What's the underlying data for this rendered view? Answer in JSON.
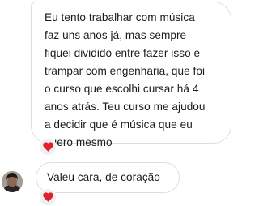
{
  "messages": [
    {
      "lines": [
        "Eu tento trabalhar com música",
        "faz uns anos já, mas sempre",
        "fiquei dividido entre fazer isso e",
        "trampar com engenharia, que foi",
        "o curso que escolhi cursar há 4",
        "anos atrás. Teu curso me ajudou",
        "a decidir que é música que eu",
        "quero mesmo"
      ],
      "reaction": "red-heart-icon"
    },
    {
      "text": "Valeu cara, de coração",
      "reaction": "red-heart-icon"
    }
  ],
  "colors": {
    "heart": "#e0202e",
    "bubble_border": "#dedede",
    "reaction_bg": "#efefef"
  }
}
